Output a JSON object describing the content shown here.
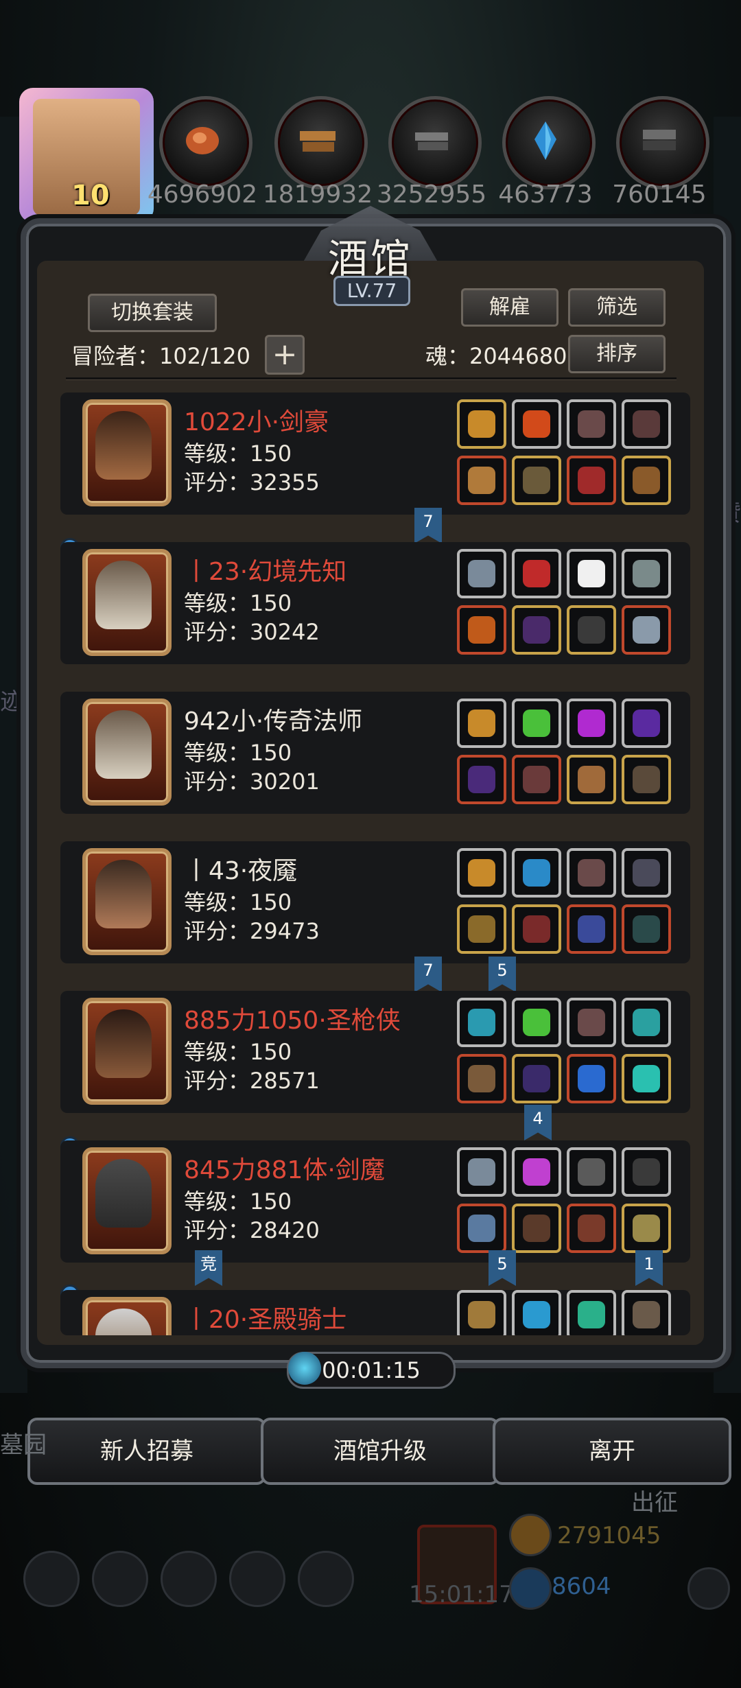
{
  "resources": {
    "avatar_level": "10",
    "values": [
      "4696902",
      "1819932",
      "3252955",
      "463773",
      "760145"
    ]
  },
  "panel": {
    "title": "酒馆",
    "level": "LV.77",
    "switch_outfit_label": "切换套装",
    "dismiss_label": "解雇",
    "filter_label": "筛选",
    "sort_label": "排序",
    "adventurers_label": "冒险者：102/120",
    "soul_label": "魂：2044680",
    "plus_label": "+"
  },
  "heroes": [
    {
      "name": "1022小·剑豪",
      "name_color": "red",
      "level": "等级：150",
      "score": "评分：32355"
    },
    {
      "name": "丨23·幻境先知",
      "name_color": "red",
      "level": "等级：150",
      "score": "评分：30242"
    },
    {
      "name": "942小·传奇法师",
      "name_color": "white",
      "level": "等级：150",
      "score": "评分：30201"
    },
    {
      "name": "丨43·夜魇",
      "name_color": "white",
      "level": "等级：150",
      "score": "评分：29473"
    },
    {
      "name": "885力1050·圣枪侠",
      "name_color": "red",
      "level": "等级：150",
      "score": "评分：28571"
    },
    {
      "name": "845力881体·剑魔",
      "name_color": "red",
      "level": "等级：150",
      "score": "评分：28420"
    },
    {
      "name": "丨20·圣殿骑士",
      "name_color": "red",
      "level": "",
      "score": ""
    }
  ],
  "flags": [
    "7",
    "7",
    "5",
    "4",
    "竞",
    "5",
    "1"
  ],
  "timer": "00:01:15",
  "bottom_buttons": {
    "recruit": "新人招募",
    "upgrade": "酒馆升级",
    "leave": "离开"
  },
  "hud": {
    "expedition": "出征",
    "gold": "2791045",
    "gems": "8604",
    "gift_timer": "15:01:17",
    "left_side_text": "墓园",
    "left_edge_char": "迹",
    "right_edge_char": "赞"
  },
  "colors": {
    "name_red": "#e04a3a",
    "name_white": "#ece7dc",
    "flag_blue": "#2c5b86"
  }
}
